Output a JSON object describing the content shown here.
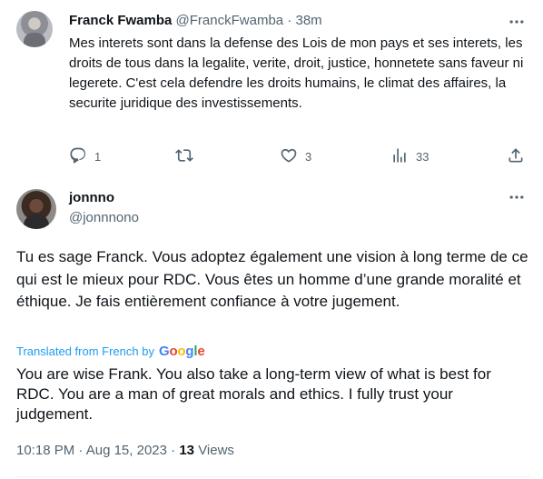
{
  "parent_tweet": {
    "display_name": "Franck Fwamba",
    "handle": "@FranckFwamba",
    "separator": "·",
    "time_ago": "38m",
    "text": "Mes interets sont dans la defense des Lois de mon pays et ses interets, les droits de tous dans la legalite, verite, droit, justice, honnetete sans faveur ni legerete. C'est cela defendre les droits humains, le climat des affaires, la securite juridique des investissements.",
    "stats": {
      "replies": "1",
      "likes": "3",
      "views": "33"
    },
    "icons": [
      "more-icon",
      "reply-icon",
      "retweet-icon",
      "like-icon",
      "views-icon",
      "share-icon"
    ]
  },
  "reply_tweet": {
    "display_name": "jonnno",
    "handle": "@jonnnono",
    "text": "Tu es sage Franck. Vous adoptez également une vision à long terme de ce qui est le mieux pour RDC. Vous êtes un homme d’une grande moralité et éthique. Je fais entièrement confiance à votre jugement.",
    "translated_label": "Translated from French by",
    "translator_brand": "Google",
    "translation": "You are wise Frank. You also take a long-term view of what is best for RDC. You are a man of great morals and ethics. I fully trust your judgement.",
    "time": "10:18 PM",
    "date": "Aug 15, 2023",
    "meta_separator": "·",
    "views_count": "13",
    "views_label": "Views"
  },
  "colors": {
    "text": "#0f1419",
    "secondary": "#536471",
    "link": "#1d9bf0",
    "google": [
      "#4285f4",
      "#ea4335",
      "#fbbc05",
      "#34a853"
    ]
  }
}
